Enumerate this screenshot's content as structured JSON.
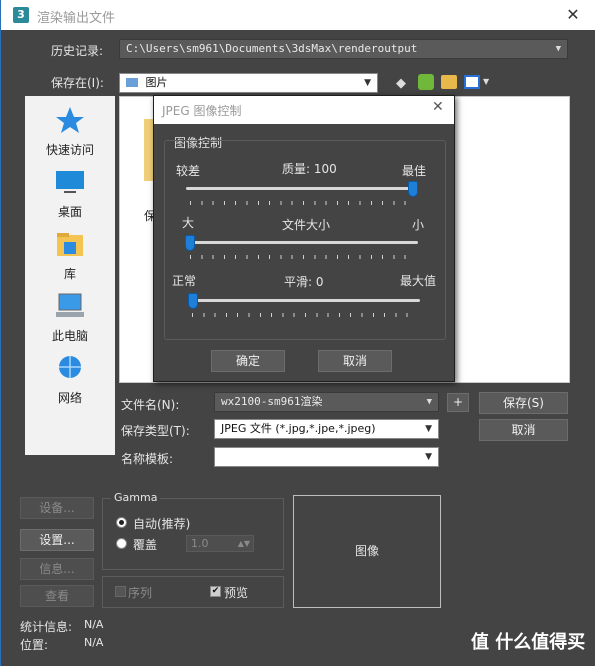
{
  "window": {
    "title": "渲染输出文件",
    "app_icon": "3",
    "close_symbol": "✕"
  },
  "history": {
    "label": "历史记录:",
    "value": "C:\\Users\\sm961\\Documents\\3dsMax\\renderoutput"
  },
  "save_in": {
    "label": "保存在(I):",
    "value": "图片"
  },
  "sidebar": {
    "items": [
      {
        "label": "快速访问",
        "icon": "star-icon"
      },
      {
        "label": "桌面",
        "icon": "desktop-icon"
      },
      {
        "label": "库",
        "icon": "library-icon"
      },
      {
        "label": "此电脑",
        "icon": "computer-icon"
      },
      {
        "label": "网络",
        "icon": "network-icon"
      }
    ]
  },
  "file_list": {
    "partial_item_label": "保"
  },
  "jpeg_dialog": {
    "title": "JPEG 图像控制",
    "group_label": "图像控制",
    "quality": {
      "left": "较差",
      "center": "质量: 100",
      "right": "最佳",
      "value": 100
    },
    "filesize": {
      "left": "大",
      "center": "文件大小",
      "right": "小"
    },
    "smooth": {
      "left": "正常",
      "center": "平滑:  0",
      "right": "最大值",
      "value": 0
    },
    "ok": "确定",
    "cancel": "取消"
  },
  "form": {
    "filename_label": "文件名(N):",
    "filename_value": "wx2100-sm961渲染",
    "filetype_label": "保存类型(T):",
    "filetype_value": "JPEG 文件 (*.jpg,*.jpe,*.jpeg)",
    "template_label": "名称模板:",
    "template_value": "",
    "plus": "+",
    "save_button": "保存(S)",
    "cancel_button": "取消"
  },
  "left_buttons": {
    "setup_disabled": "设备...",
    "setup": "设置...",
    "info": "信息...",
    "view": "查看"
  },
  "gamma": {
    "label": "Gamma",
    "auto": "自动(推荐)",
    "override": "覆盖",
    "override_value": "1.0"
  },
  "options": {
    "sequence": "序列",
    "preview": "预览"
  },
  "preview_box": "图像",
  "stats": {
    "stats_label": "统计信息:",
    "stats_value": "N/A",
    "location_label": "位置:",
    "location_value": "N/A"
  },
  "watermark": "值 什么值得买"
}
